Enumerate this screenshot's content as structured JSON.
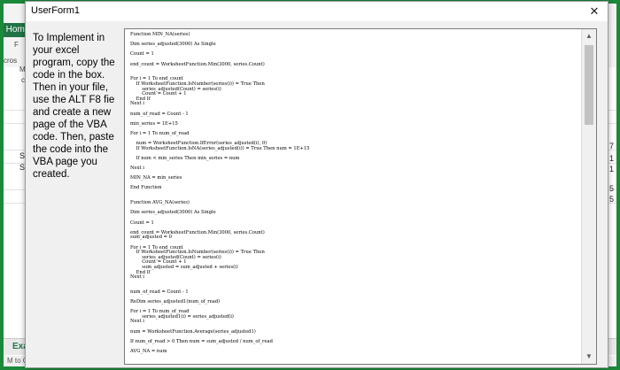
{
  "window": {
    "title": "UserForm1",
    "close_glyph": "✕"
  },
  "instructions": "To Implement in your excel program, copy the code in the box. Then in your file, use the ALT F8 fie and create a new page of the VBA code. Then, paste the code into the VBA page you created.",
  "code": "Function MIN_NA(series)\n\nDim series_adjusted(3000) As Single\n\nCount = 1\n\nend_count = WorksheetFunction.Min(3000, series.Count)\n\n\nFor i = 1 To end_count\n    If WorksheetFunction.IsNumber(series(i)) = True Then\n        series_adjusted(Count) = series(i)\n        Count = Count + 1\n    End If\nNext i\n\nnum_of_read = Count - 1\n\nmin_series = 1E+15\n\nFor i = 1 To num_of_read\n\n    num = WorksheetFunction.IfError(series_adjusted(i), 0)\n    If WorksheetFunction.IsNA(series_adjusted(i)) = True Then num = 1E+15\n\n    If num < min_series Then min_series = num\n\nNext i\n\nMIN_NA = min_series\n\nEnd Function\n\n\nFunction AVG_NA(series)\n\nDim series_adjusted(3000) As Single\n\nCount = 1\n\nend_count = WorksheetFunction.Min(3000, series.Count)\nsum_adjusted = 0\n\nFor i = 1 To end_count\n    If WorksheetFunction.IsNumber(series(i)) = True Then\n        series_adjusted(Count) = series(i)\n        Count = Count + 1\n        sum_adjusted = sum_adjusted + series(i)\n    End If\nNext i\n\n\nnum_of_read = Count - 1\n\nReDim series_adjusted1(num_of_read)\n\nFor i = 1 To num_of_read\n        series_adjusted1(i) = series_adjusted(i)\nNext i\n\nnum = WorksheetFunction.Average(series_adjusted1)\n\nIf num_of_read > 0 Then num = sum_adjusted / num_of_read\n\nAVG_NA = num\n\n\nEnd Function",
  "excel": {
    "home_tab": "Home",
    "ribbon_fragments": [
      "F",
      "cros",
      "M",
      "c"
    ],
    "row_labels": [
      "Se",
      "Se"
    ],
    "sheet_tab": "Exa",
    "status": "M to Clea",
    "right_numbers": [
      "7",
      "1",
      "1",
      "5",
      "5"
    ]
  }
}
